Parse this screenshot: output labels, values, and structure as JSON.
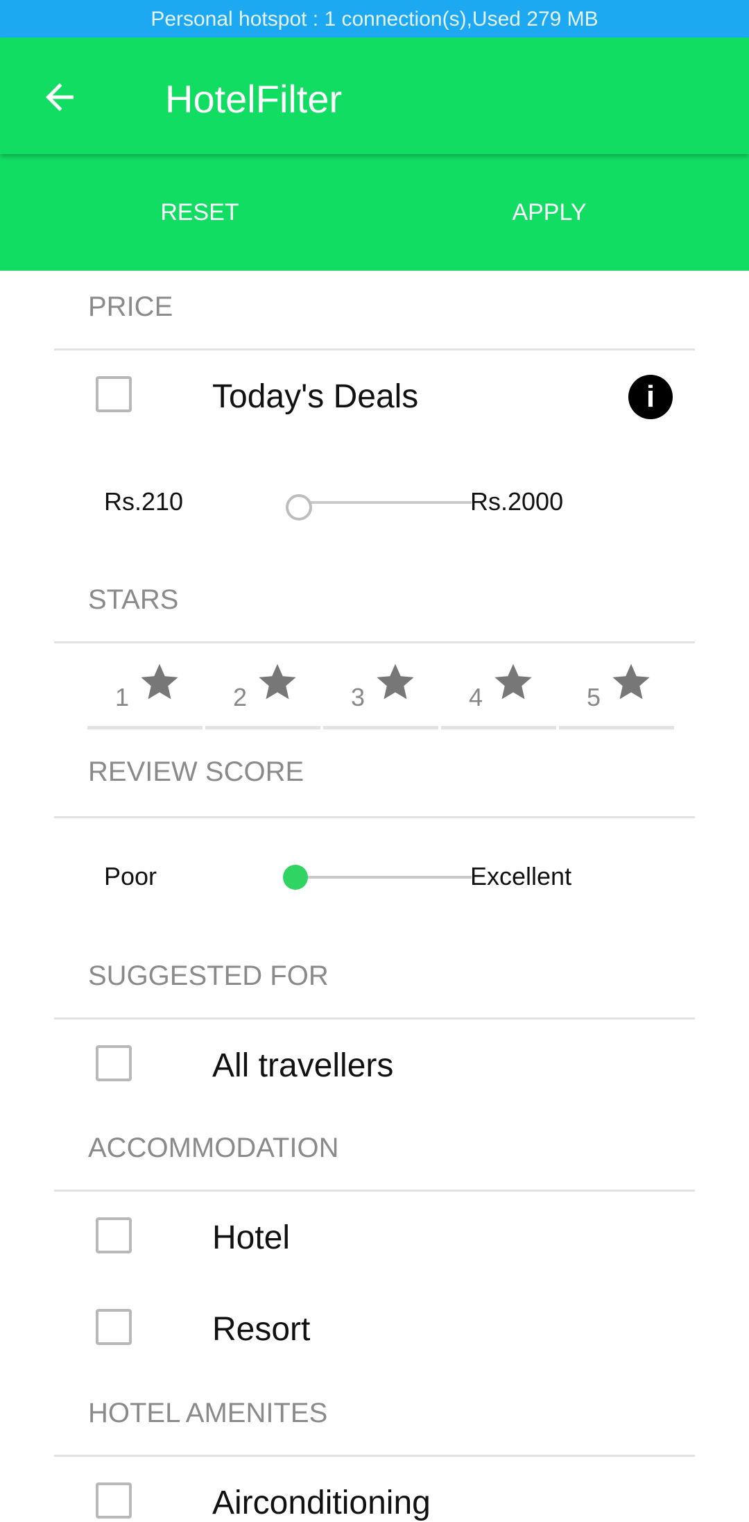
{
  "status_bar": {
    "text": "Personal hotspot : 1 connection(s),Used  279 MB"
  },
  "app_bar": {
    "title": "HotelFilter"
  },
  "actions": {
    "reset": "RESET",
    "apply": "APPLY"
  },
  "price": {
    "heading": "PRICE",
    "todays_deals": "Today's Deals",
    "info_glyph": "i",
    "min_label": "Rs.210",
    "max_label": "Rs.2000"
  },
  "stars": {
    "heading": "STARS",
    "items": [
      "1",
      "2",
      "3",
      "4",
      "5"
    ]
  },
  "review_score": {
    "heading": "REVIEW SCORE",
    "min_label": "Poor",
    "max_label": "Excellent"
  },
  "suggested_for": {
    "heading": "SUGGESTED FOR",
    "options": [
      "All travellers"
    ]
  },
  "accommodation": {
    "heading": "ACCOMMODATION",
    "options": [
      "Hotel",
      "Resort"
    ]
  },
  "hotel_amenities": {
    "heading": "HOTEL AMENITES",
    "options": [
      "Airconditioning"
    ]
  },
  "colors": {
    "status_bar": "#1da9f2",
    "app_bar": "#12dd63",
    "accent": "#2fd462",
    "star": "#777777"
  }
}
